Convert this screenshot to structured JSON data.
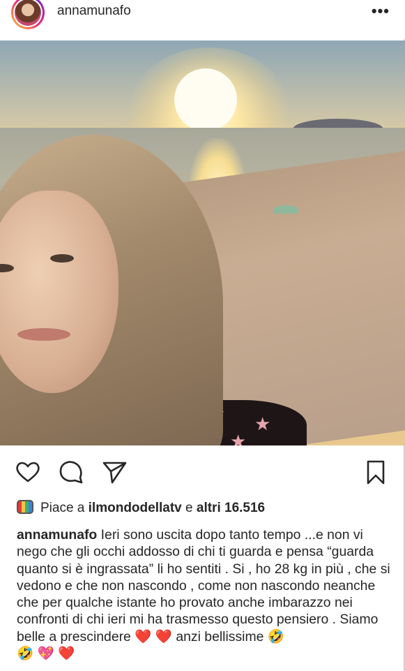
{
  "post": {
    "username": "annamunafo",
    "more_icon": "more-horizontal-icon"
  },
  "actions": {
    "like_icon": "heart-icon",
    "comment_icon": "comment-icon",
    "share_icon": "send-icon",
    "save_icon": "bookmark-icon"
  },
  "likes": {
    "prefix": "Piace a",
    "liker": "ilmondodellatv",
    "connector": "e",
    "others": "altri 16.516"
  },
  "caption": {
    "username": "annamunafo",
    "text": "Ieri sono uscita dopo tanto tempo ...e non vi nego che gli occhi addosso di chi ti guarda e pensa “guarda quanto si è ingrassata” li ho sentiti . Si , ho 28 kg in più , che si vedono e che non nascondo , come non nascondo neanche che per qualche istante ho provato anche imbarazzo nei confronti di chi ieri mi ha trasmesso questo pensiero . Siamo belle a prescindere",
    "emoji_hearts": "❤️ ❤️",
    "after_hearts": "anzi bellissime",
    "emoji_laugh": "🤣",
    "overflow_emojis": "🤣 💖 ❤️"
  },
  "colors": {
    "text": "#262626",
    "heart": "#e0122e"
  }
}
